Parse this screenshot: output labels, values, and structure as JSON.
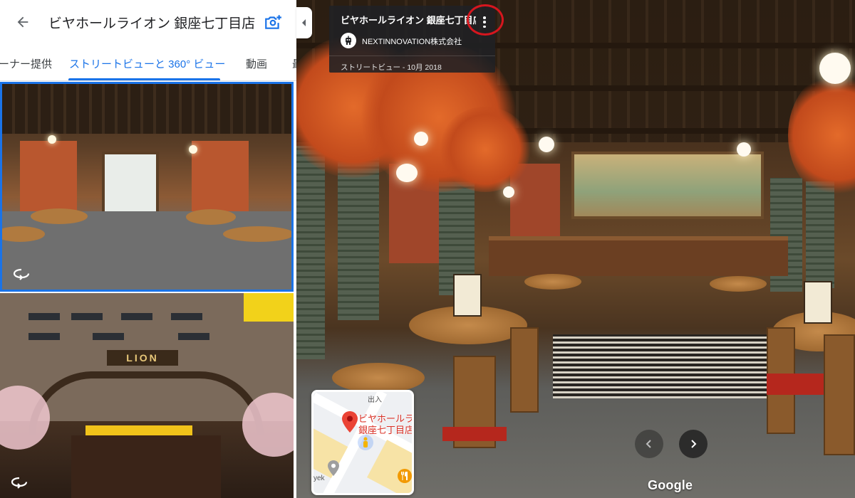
{
  "left_panel": {
    "title": "ビヤホールライオン 銀座七丁目店",
    "tabs": [
      {
        "label": "ーナー提供",
        "active": false
      },
      {
        "label": "ストリートビューと 360° ビュー",
        "active": true
      },
      {
        "label": "動画",
        "active": false
      },
      {
        "label": "最",
        "active": false
      }
    ],
    "thumbnails": [
      {
        "kind": "360-interior",
        "selected": true,
        "icon": "360-rotate-icon"
      },
      {
        "kind": "exterior",
        "selected": false,
        "icon": "360-rotate-icon",
        "sign_text": "LION"
      }
    ]
  },
  "info_card": {
    "title": "ビヤホールライオン 銀座七丁目店",
    "owner": "NEXTINNOVATION株式会社",
    "date": "ストリートビュー - 10月 2018"
  },
  "minimap": {
    "place_label_line1": "ビヤホールラ",
    "place_label_line2": "銀座七丁目店",
    "street_label": "出入",
    "side_label": "yek"
  },
  "brand": "Google",
  "colors": {
    "accent": "#1a73e8",
    "highlight_circle": "#d6161e",
    "pin": "#ea4335"
  }
}
